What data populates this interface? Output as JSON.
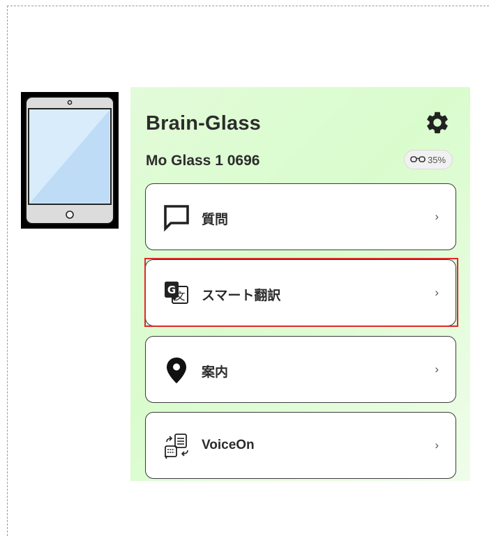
{
  "app": {
    "title": "Brain-Glass",
    "device_name": "Mo Glass 1 0696",
    "battery": "35%"
  },
  "menu": {
    "items": [
      {
        "id": "question",
        "label": "質問",
        "icon": "chat-bubble-icon",
        "chevron": "›"
      },
      {
        "id": "smart-translate",
        "label": "スマート翻訳",
        "icon": "translate-icon",
        "chevron": "›"
      },
      {
        "id": "guide",
        "label": "案内",
        "icon": "location-pin-icon",
        "chevron": "›"
      },
      {
        "id": "voiceon",
        "label": "VoiceOn",
        "icon": "voice-conversation-icon",
        "chevron": "›"
      }
    ]
  },
  "icons": {
    "tablet": "tablet-icon",
    "settings": "gear-icon",
    "battery": "glasses-icon"
  },
  "colors": {
    "panel_background": "#dcfbcf",
    "highlight": "#e0282a",
    "text": "#2c2c2c"
  }
}
